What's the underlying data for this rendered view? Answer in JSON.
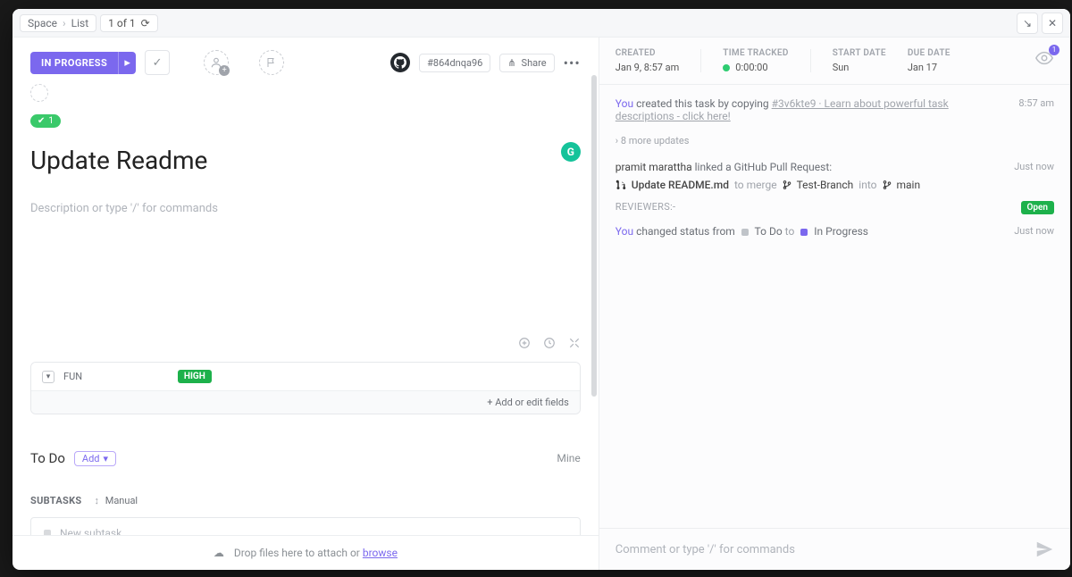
{
  "breadcrumb": {
    "space": "Space",
    "list": "List",
    "position": "1 of 1"
  },
  "leftHeader": {
    "status": "IN PROGRESS",
    "taskId": "#864dnqa96",
    "share": "Share"
  },
  "badge": {
    "count": "1"
  },
  "task": {
    "title": "Update Readme",
    "descriptionPlaceholder": "Description or type '/' for commands"
  },
  "customFields": {
    "name": "FUN",
    "tag": "HIGH",
    "footer": "+ Add or edit fields"
  },
  "todo": {
    "label": "To Do",
    "add": "Add",
    "mine": "Mine"
  },
  "subtasks": {
    "header": "SUBTASKS",
    "sort": "Manual",
    "placeholder": "New subtask"
  },
  "leftFooter": {
    "text": "Drop files here to attach or ",
    "link": "browse"
  },
  "rightHeader": {
    "createdLabel": "CREATED",
    "createdValue": "Jan 9, 8:57 am",
    "timeTrackedLabel": "TIME TRACKED",
    "timeTrackedValue": "0:00:00",
    "startLabel": "START DATE",
    "startValue": "Sun",
    "dueLabel": "DUE DATE",
    "dueValue": "Jan 17",
    "watchCount": "1"
  },
  "feed": {
    "i1_you": "You",
    "i1_text": " created this task by copying ",
    "i1_link": "#3v6kte9 · Learn about powerful task descriptions - click here!",
    "i1_ts": "8:57 am",
    "more": "8 more updates",
    "i2_user": "pramit marattha",
    "i2_text": " linked a GitHub Pull Request:",
    "i2_ts": "Just now",
    "pr_title": "Update README.md",
    "pr_merge": " to merge ",
    "pr_from": "Test-Branch",
    "pr_into": " into ",
    "pr_to": "main",
    "reviewers": "REVIEWERS:-",
    "open": "Open",
    "i3_you": "You",
    "i3_text": " changed status from ",
    "i3_from": "To Do",
    "i3_to_word": "  to  ",
    "i3_to": "In Progress",
    "i3_ts": "Just now"
  },
  "rightFooter": {
    "placeholder": "Comment or type '/' for commands"
  }
}
